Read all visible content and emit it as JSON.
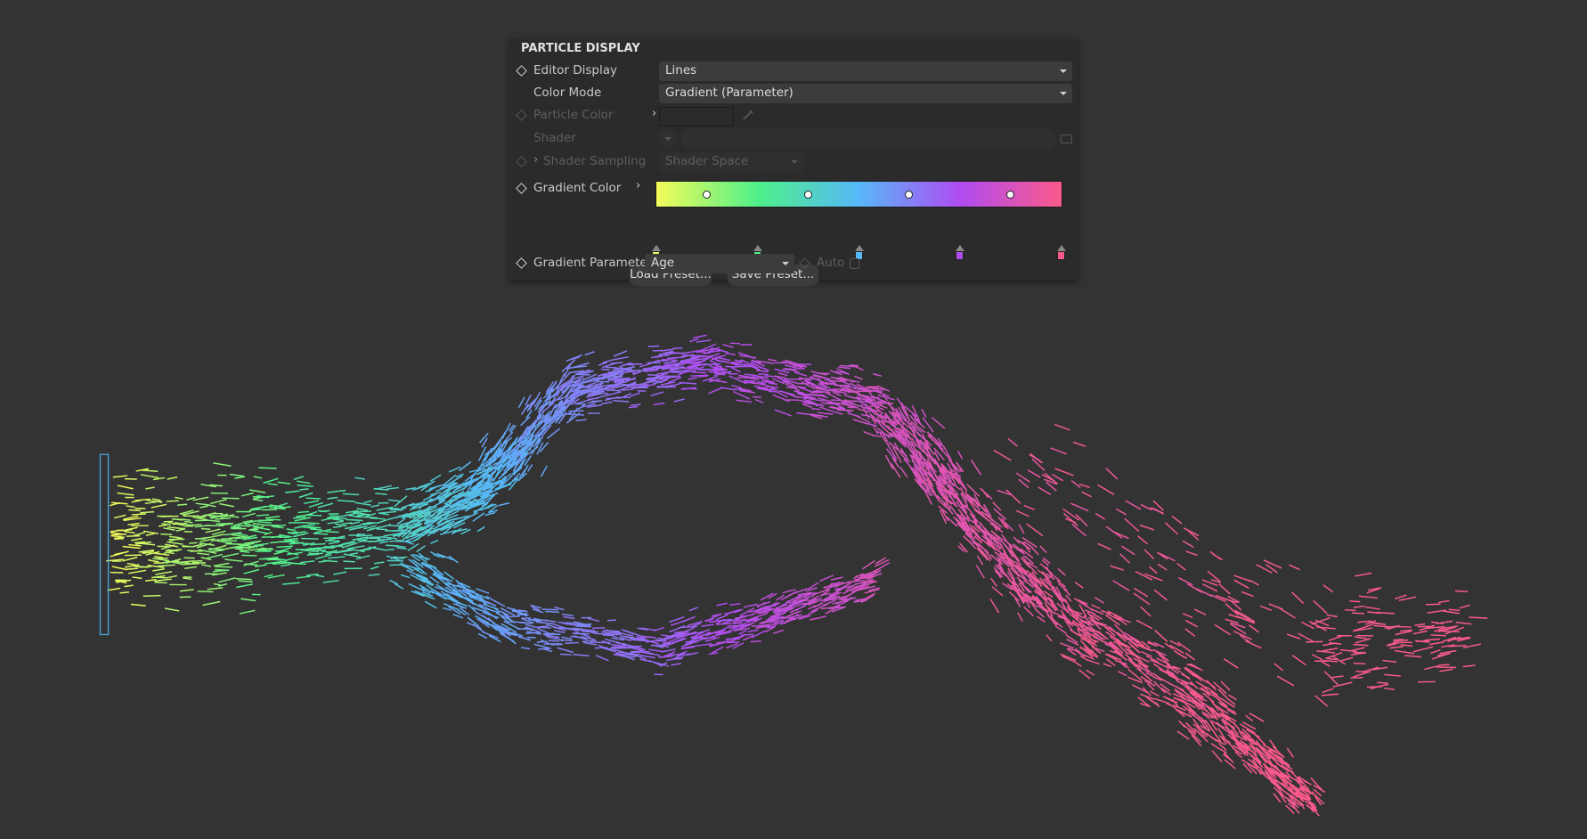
{
  "panel": {
    "title": "PARTICLE DISPLAY",
    "editor_display": {
      "label": "Editor Display",
      "value": "Lines"
    },
    "color_mode": {
      "label": "Color Mode",
      "value": "Gradient (Parameter)"
    },
    "particle_color": {
      "label": "Particle Color"
    },
    "shader": {
      "label": "Shader"
    },
    "shader_sampling": {
      "label": "Shader Sampling",
      "value": "Shader Space"
    },
    "gradient_color": {
      "label": "Gradient Color",
      "stops": [
        "#f4fb5a",
        "#4ff08a",
        "#56b8f8",
        "#b04cf2",
        "#fb5a8a"
      ]
    },
    "load_preset": "Load Preset...",
    "save_preset": "Save Preset...",
    "gradient_parameter": {
      "label": "Gradient Parameter",
      "value": "Age",
      "auto_label": "Auto",
      "auto_checked": false
    }
  },
  "viewport": {
    "background": "#333333",
    "emitter_color": "#4aa3d8"
  }
}
